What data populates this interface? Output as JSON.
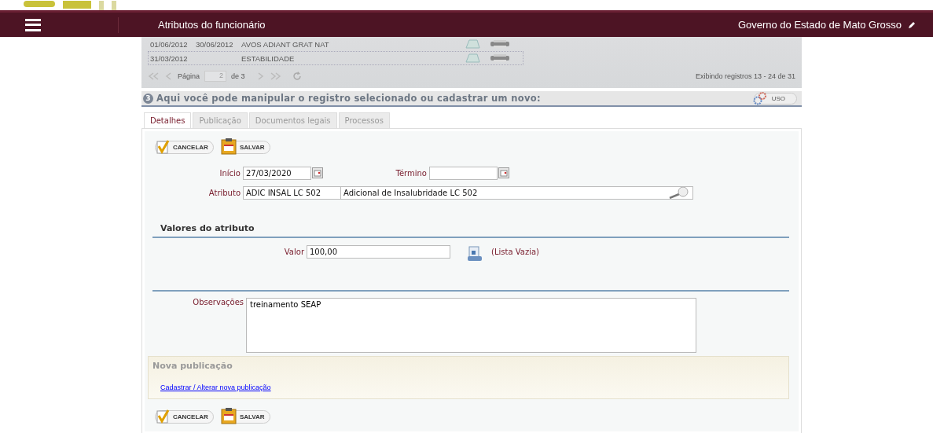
{
  "header": {
    "title": "Atributos do funcionário",
    "org": "Governo do Estado de Mato Grosso"
  },
  "grid": {
    "rows": [
      {
        "start": "01/06/2012",
        "end": "30/06/2012",
        "description": "AVOS ADIANT GRAT NAT"
      },
      {
        "start": "31/03/2012",
        "description": "ESTABILIDADE"
      }
    ],
    "pager": {
      "page_label": "Página",
      "page": "2",
      "of": "de 3",
      "info": "Exibindo registros 13 - 24 de 31"
    }
  },
  "section": {
    "number": "3",
    "title": "Aqui você pode manipular o registro selecionado ou cadastrar um novo:",
    "uso": "USO"
  },
  "tabs": [
    {
      "label": "Detalhes",
      "selected": true
    },
    {
      "label": "Publicação",
      "selected": false
    },
    {
      "label": "Documentos legais",
      "selected": false
    },
    {
      "label": "Processos",
      "selected": false
    }
  ],
  "top_buttons": [
    {
      "kind": "cancel",
      "label": "CANCELAR"
    },
    {
      "kind": "save",
      "label": "SALVAR"
    }
  ],
  "inicio": {
    "label": "Início",
    "value": "27/03/2020"
  },
  "termino": {
    "label": "Término"
  },
  "atributo": {
    "label": "Atributo",
    "code": "ADIC INSAL LC 502",
    "description": "Adicional de Insalubridade LC 502"
  },
  "valores": {
    "title": "Valores do atributo",
    "label": "Valor",
    "value": "100,00",
    "list_note": "(Lista Vazia)"
  },
  "observacoes": {
    "label": "Observações",
    "value": "treinamento SEAP"
  },
  "nova_publicacao": {
    "title": "Nova publicação",
    "link": "Cadastrar / Alterar nova publicação"
  },
  "bottom_buttons": [
    {
      "kind": "cancel",
      "label": "CANCELAR"
    },
    {
      "kind": "save",
      "label": "SALVAR"
    }
  ]
}
